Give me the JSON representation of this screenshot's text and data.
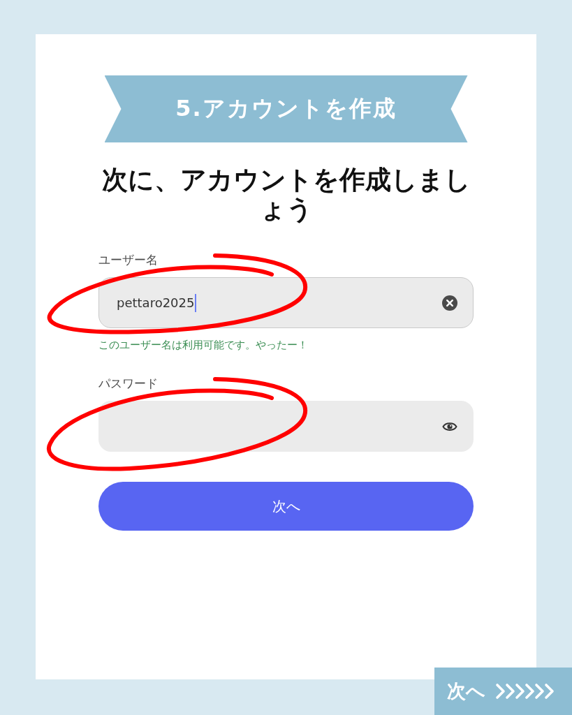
{
  "banner": {
    "title": "5.アカウントを作成"
  },
  "heading": "次に、アカウントを作成しましょう",
  "fields": [
    {
      "kind": "text",
      "label": "ユーザー名",
      "value": "pettaro2025",
      "focused": true,
      "annotated": true,
      "message": "このユーザー名は利用可能です。やったー！"
    },
    {
      "kind": "password",
      "label": "パスワード",
      "focused": false,
      "annotated": true
    }
  ],
  "submit_button": {
    "label": "次へ"
  },
  "next_tab": {
    "label": "次へ"
  }
}
